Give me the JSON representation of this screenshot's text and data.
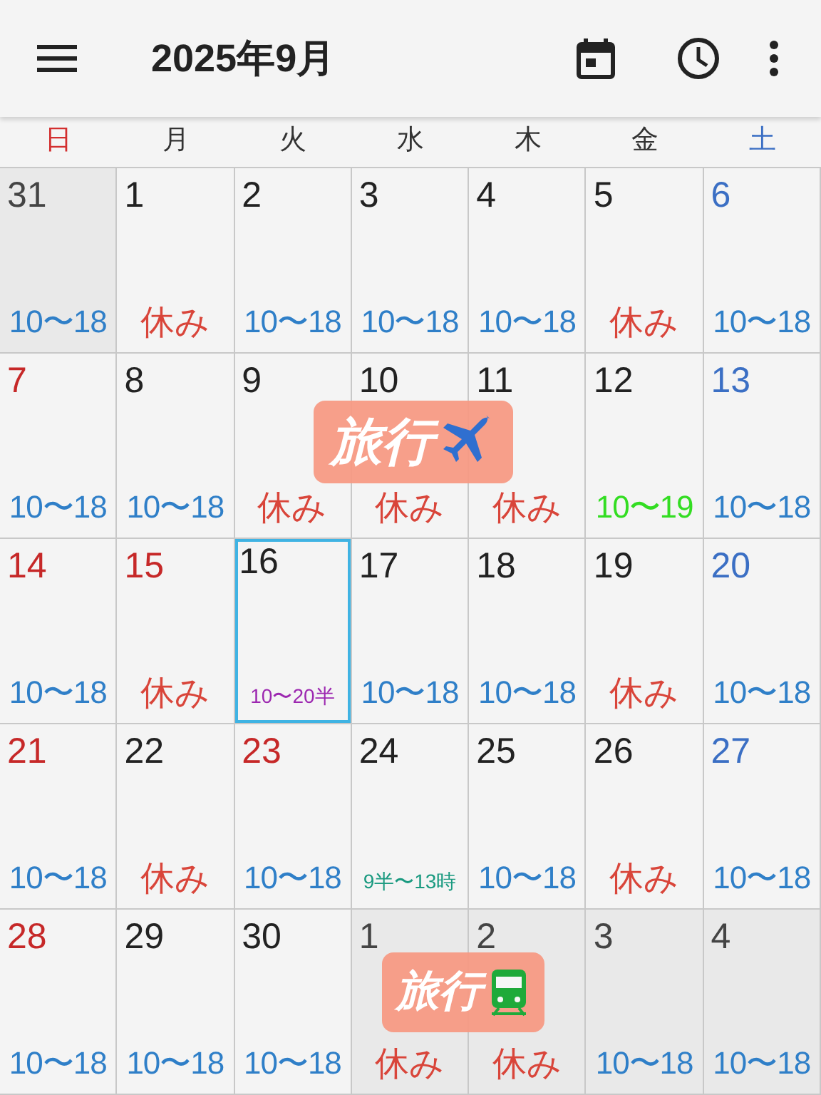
{
  "app_bar": {
    "title": "2025年9月"
  },
  "weekdays": [
    {
      "label": "日",
      "kind": "sunday"
    },
    {
      "label": "月",
      "kind": "weekday"
    },
    {
      "label": "火",
      "kind": "weekday"
    },
    {
      "label": "水",
      "kind": "weekday"
    },
    {
      "label": "木",
      "kind": "weekday"
    },
    {
      "label": "金",
      "kind": "weekday"
    },
    {
      "label": "土",
      "kind": "saturday"
    }
  ],
  "weeks": [
    [
      {
        "day": "31",
        "kind": "weekday",
        "in_month": false,
        "selected": false,
        "entry": {
          "text": "10〜18",
          "kind": "hours"
        }
      },
      {
        "day": "1",
        "kind": "weekday",
        "in_month": true,
        "selected": false,
        "entry": {
          "text": "休み",
          "kind": "off"
        }
      },
      {
        "day": "2",
        "kind": "weekday",
        "in_month": true,
        "selected": false,
        "entry": {
          "text": "10〜18",
          "kind": "hours"
        }
      },
      {
        "day": "3",
        "kind": "weekday",
        "in_month": true,
        "selected": false,
        "entry": {
          "text": "10〜18",
          "kind": "hours"
        }
      },
      {
        "day": "4",
        "kind": "weekday",
        "in_month": true,
        "selected": false,
        "entry": {
          "text": "10〜18",
          "kind": "hours"
        }
      },
      {
        "day": "5",
        "kind": "weekday",
        "in_month": true,
        "selected": false,
        "entry": {
          "text": "休み",
          "kind": "off"
        }
      },
      {
        "day": "6",
        "kind": "saturday",
        "in_month": true,
        "selected": false,
        "entry": {
          "text": "10〜18",
          "kind": "hours"
        }
      }
    ],
    [
      {
        "day": "7",
        "kind": "sunday",
        "in_month": true,
        "selected": false,
        "entry": {
          "text": "10〜18",
          "kind": "hours"
        }
      },
      {
        "day": "8",
        "kind": "weekday",
        "in_month": true,
        "selected": false,
        "entry": {
          "text": "10〜18",
          "kind": "hours"
        }
      },
      {
        "day": "9",
        "kind": "weekday",
        "in_month": true,
        "selected": false,
        "entry": {
          "text": "休み",
          "kind": "off"
        }
      },
      {
        "day": "10",
        "kind": "weekday",
        "in_month": true,
        "selected": false,
        "entry": {
          "text": "休み",
          "kind": "off"
        }
      },
      {
        "day": "11",
        "kind": "weekday",
        "in_month": true,
        "selected": false,
        "entry": {
          "text": "休み",
          "kind": "off"
        }
      },
      {
        "day": "12",
        "kind": "weekday",
        "in_month": true,
        "selected": false,
        "entry": {
          "text": "10〜19",
          "kind": "note",
          "color": "#33dd22"
        }
      },
      {
        "day": "13",
        "kind": "saturday",
        "in_month": true,
        "selected": false,
        "entry": {
          "text": "10〜18",
          "kind": "hours"
        }
      }
    ],
    [
      {
        "day": "14",
        "kind": "sunday",
        "in_month": true,
        "selected": false,
        "entry": {
          "text": "10〜18",
          "kind": "hours"
        }
      },
      {
        "day": "15",
        "kind": "holiday",
        "in_month": true,
        "selected": false,
        "entry": {
          "text": "休み",
          "kind": "off"
        }
      },
      {
        "day": "16",
        "kind": "weekday",
        "in_month": true,
        "selected": true,
        "entry": {
          "text": "10〜20半",
          "kind": "small_note",
          "color": "#9c27b0"
        }
      },
      {
        "day": "17",
        "kind": "weekday",
        "in_month": true,
        "selected": false,
        "entry": {
          "text": "10〜18",
          "kind": "hours"
        }
      },
      {
        "day": "18",
        "kind": "weekday",
        "in_month": true,
        "selected": false,
        "entry": {
          "text": "10〜18",
          "kind": "hours"
        }
      },
      {
        "day": "19",
        "kind": "weekday",
        "in_month": true,
        "selected": false,
        "entry": {
          "text": "休み",
          "kind": "off"
        }
      },
      {
        "day": "20",
        "kind": "saturday",
        "in_month": true,
        "selected": false,
        "entry": {
          "text": "10〜18",
          "kind": "hours"
        }
      }
    ],
    [
      {
        "day": "21",
        "kind": "sunday",
        "in_month": true,
        "selected": false,
        "entry": {
          "text": "10〜18",
          "kind": "hours"
        }
      },
      {
        "day": "22",
        "kind": "weekday",
        "in_month": true,
        "selected": false,
        "entry": {
          "text": "休み",
          "kind": "off"
        }
      },
      {
        "day": "23",
        "kind": "holiday",
        "in_month": true,
        "selected": false,
        "entry": {
          "text": "10〜18",
          "kind": "hours"
        }
      },
      {
        "day": "24",
        "kind": "weekday",
        "in_month": true,
        "selected": false,
        "entry": {
          "text": "9半〜13時",
          "kind": "small_note",
          "color": "#1a9a80"
        }
      },
      {
        "day": "25",
        "kind": "weekday",
        "in_month": true,
        "selected": false,
        "entry": {
          "text": "10〜18",
          "kind": "hours"
        }
      },
      {
        "day": "26",
        "kind": "weekday",
        "in_month": true,
        "selected": false,
        "entry": {
          "text": "休み",
          "kind": "off"
        }
      },
      {
        "day": "27",
        "kind": "saturday",
        "in_month": true,
        "selected": false,
        "entry": {
          "text": "10〜18",
          "kind": "hours"
        }
      }
    ],
    [
      {
        "day": "28",
        "kind": "sunday",
        "in_month": true,
        "selected": false,
        "entry": {
          "text": "10〜18",
          "kind": "hours"
        }
      },
      {
        "day": "29",
        "kind": "weekday",
        "in_month": true,
        "selected": false,
        "entry": {
          "text": "10〜18",
          "kind": "hours"
        }
      },
      {
        "day": "30",
        "kind": "weekday",
        "in_month": true,
        "selected": false,
        "entry": {
          "text": "10〜18",
          "kind": "hours"
        }
      },
      {
        "day": "1",
        "kind": "weekday",
        "in_month": false,
        "selected": false,
        "entry": {
          "text": "休み",
          "kind": "off"
        }
      },
      {
        "day": "2",
        "kind": "weekday",
        "in_month": false,
        "selected": false,
        "entry": {
          "text": "休み",
          "kind": "off"
        }
      },
      {
        "day": "3",
        "kind": "weekday",
        "in_month": false,
        "selected": false,
        "entry": {
          "text": "10〜18",
          "kind": "hours"
        }
      },
      {
        "day": "4",
        "kind": "weekday",
        "in_month": false,
        "selected": false,
        "entry": {
          "text": "10〜18",
          "kind": "hours"
        }
      }
    ]
  ],
  "stickers": [
    {
      "text": "旅行",
      "kind": "plane"
    },
    {
      "text": "旅行",
      "kind": "train"
    }
  ]
}
